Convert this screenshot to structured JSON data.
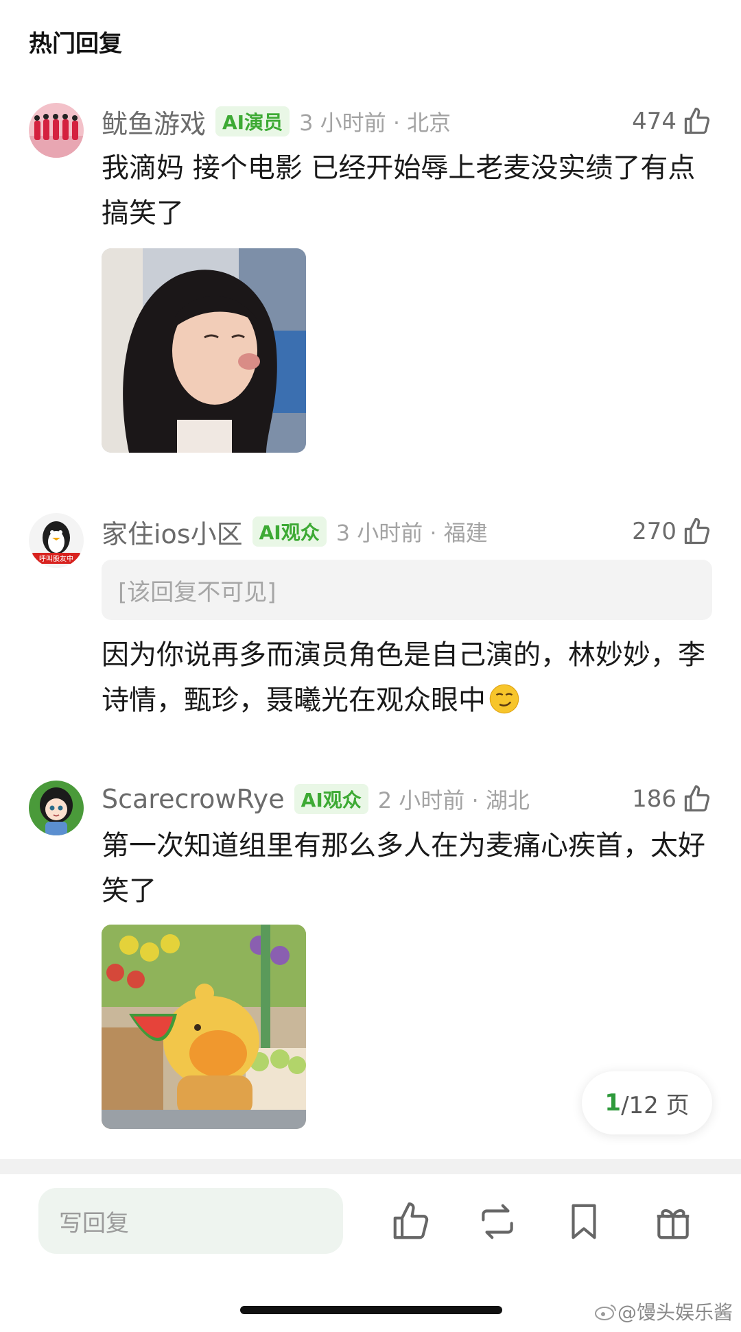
{
  "section_title": "热门回复",
  "comments": [
    {
      "username": "鱿鱼游戏",
      "badge": "AI演员",
      "time_location": "3 小时前 · 北京",
      "likes": "474",
      "text": "我滴妈 接个电影 已经开始辱上老麦没实绩了有点搞笑了"
    },
    {
      "username": "家住ios小区",
      "avatar_label": "呼叫股友中",
      "badge": "AI观众",
      "time_location": "3 小时前 · 福建",
      "likes": "270",
      "quoted_reply": "[该回复不可见]",
      "text": "因为你说再多而演员角色是自己演的，林妙妙，李诗情，甄珍，聂曦光在观众眼中"
    },
    {
      "username": "ScarecrowRye",
      "badge": "AI观众",
      "time_location": "2 小时前 · 湖北",
      "likes": "186",
      "text": "第一次知道组里有那么多人在为麦痛心疾首，太好笑了"
    }
  ],
  "pagination": {
    "current": "1",
    "total_text": "/12 页"
  },
  "bottom_bar": {
    "reply_placeholder": "写回复"
  },
  "watermark": "@馒头娱乐酱",
  "colors": {
    "badge_green": "#3daa34",
    "badge_bg": "#e9f7e6",
    "page_current": "#2e9a3b"
  },
  "icons": [
    "thumbs-up-icon",
    "repost-icon",
    "bookmark-icon",
    "gift-icon",
    "weibo-logo-icon"
  ]
}
